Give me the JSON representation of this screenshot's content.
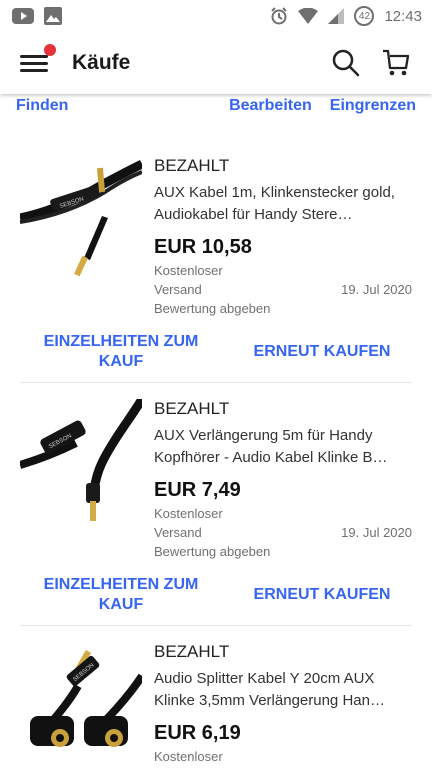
{
  "status_bar": {
    "battery": "42",
    "time": "12:43"
  },
  "header": {
    "title": "Käufe"
  },
  "actions": {
    "find": "Finden",
    "edit": "Bearbeiten",
    "refine": "Eingrenzen"
  },
  "orders": [
    {
      "status": "BEZAHLT",
      "title": "AUX Kabel 1m, Klinkenstecker gold, Audiokabel für Handy Stere…",
      "price": "EUR 10,58",
      "shipping_line1": "Kostenloser",
      "shipping_line2": "Versand",
      "date": "19. Jul 2020",
      "feedback": "Bewertung abgeben",
      "details_button": "EINZELHEITEN ZUM KAUF",
      "rebuy_button": "ERNEUT KAUFEN",
      "thumb_label": "SEBSON"
    },
    {
      "status": "BEZAHLT",
      "title": "AUX Verlängerung 5m für Handy Kopfhörer - Audio Kabel Klinke B…",
      "price": "EUR 7,49",
      "shipping_line1": "Kostenloser",
      "shipping_line2": "Versand",
      "date": "19. Jul 2020",
      "feedback": "Bewertung abgeben",
      "details_button": "EINZELHEITEN ZUM KAUF",
      "rebuy_button": "ERNEUT KAUFEN",
      "thumb_label": "SEBSON"
    },
    {
      "status": "BEZAHLT",
      "title": "Audio Splitter Kabel Y 20cm AUX Klinke 3,5mm Verlängerung Han…",
      "price": "EUR 6,19",
      "shipping_line1": "Kostenloser",
      "thumb_label": "SEBSON"
    }
  ],
  "colors": {
    "accent": "#3665f3",
    "badge": "#e53238"
  }
}
